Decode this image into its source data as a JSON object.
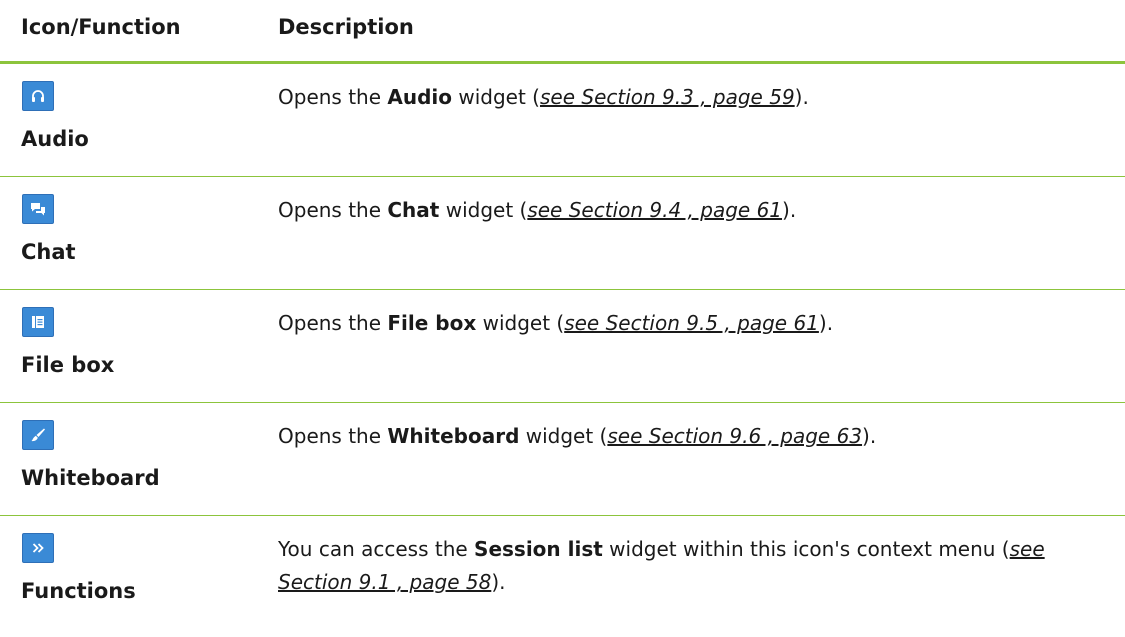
{
  "table": {
    "headers": [
      "Icon/Function",
      "Description"
    ],
    "rows": [
      {
        "icon": "headset-icon",
        "label": "Audio",
        "desc_before": "Opens the ",
        "desc_bold": "Audio",
        "desc_after": " widget (",
        "xref": "see Section 9.3 , page 59",
        "desc_end": ")."
      },
      {
        "icon": "chat-bubbles-icon",
        "label": "Chat",
        "desc_before": "Opens the ",
        "desc_bold": "Chat",
        "desc_after": " widget (",
        "xref": "see Section 9.4 , page 61",
        "desc_end": ")."
      },
      {
        "icon": "file-stack-icon",
        "label": "File box",
        "desc_before": "Opens the ",
        "desc_bold": "File box",
        "desc_after": " widget (",
        "xref": "see Section 9.5 , page 61",
        "desc_end": ")."
      },
      {
        "icon": "brush-icon",
        "label": "Whiteboard",
        "desc_before": "Opens the ",
        "desc_bold": "Whiteboard",
        "desc_after": " widget (",
        "xref": "see Section 9.6 , page 63",
        "desc_end": ")."
      },
      {
        "icon": "double-chevron-right-icon",
        "label": "Functions",
        "desc_before": "You can access the ",
        "desc_bold": "Session list",
        "desc_after": " widget within this icon's context menu (",
        "xref": "see Section 9.1 , page 58",
        "desc_end": ")."
      }
    ]
  },
  "colors": {
    "rule": "#8cc43c",
    "icon_fill": "#3a8ad6",
    "icon_border": "#2e6fb7"
  }
}
